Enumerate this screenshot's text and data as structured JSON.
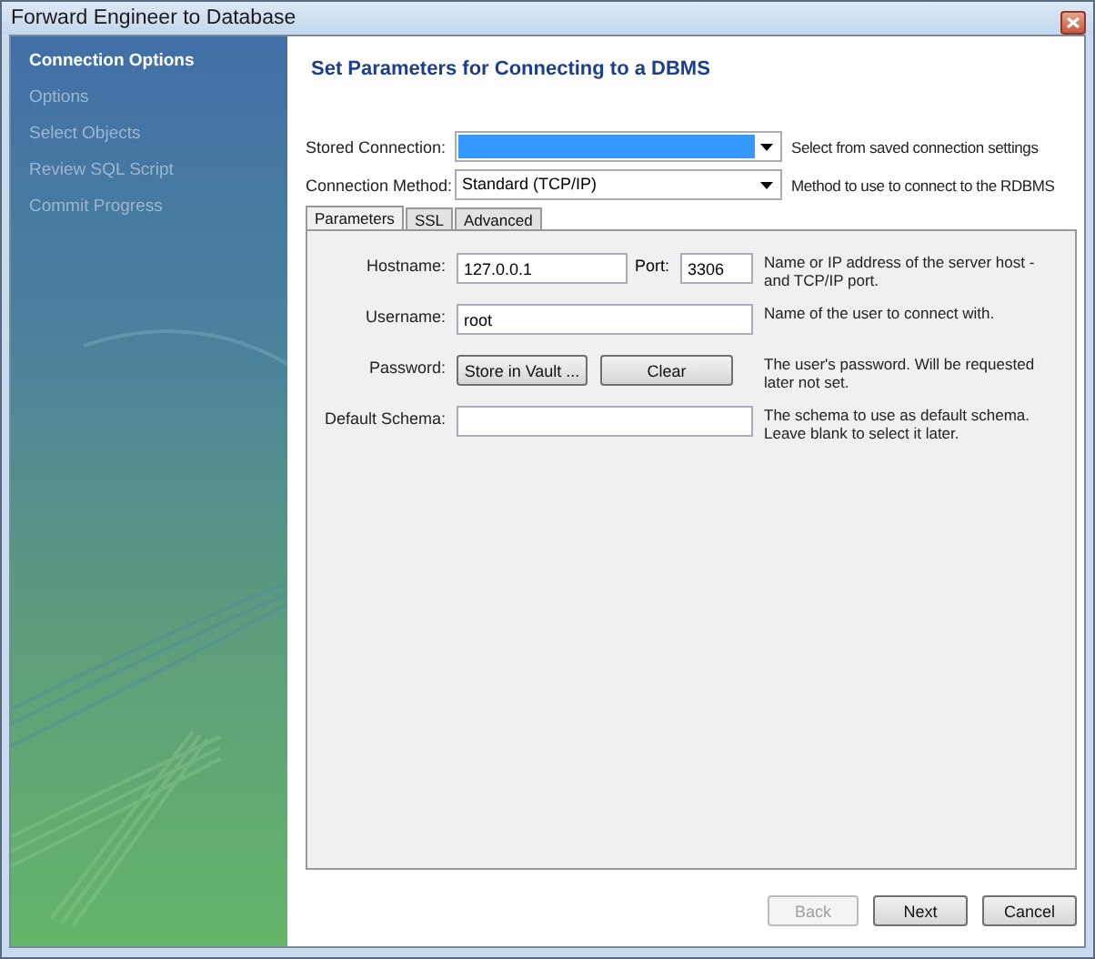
{
  "window": {
    "title": "Forward Engineer to Database"
  },
  "sidebar": {
    "items": [
      {
        "label": "Connection Options",
        "selected": true
      },
      {
        "label": "Options",
        "selected": false
      },
      {
        "label": "Select Objects",
        "selected": false
      },
      {
        "label": "Review SQL Script",
        "selected": false
      },
      {
        "label": "Commit Progress",
        "selected": false
      }
    ]
  },
  "heading": "Set Parameters for Connecting to a DBMS",
  "top_fields": [
    {
      "label": "Stored Connection:",
      "highlighted": true,
      "help": "Select from saved connection settings"
    },
    {
      "label": "Connection Method:",
      "value": "Standard (TCP/IP)",
      "highlighted": false,
      "help": "Method to use to connect to the RDBMS"
    }
  ],
  "tabs": [
    {
      "label": "Parameters",
      "selected": true
    },
    {
      "label": "SSL",
      "selected": false
    },
    {
      "label": "Advanced",
      "selected": false
    }
  ],
  "parameters": [
    {
      "kind": "host",
      "label": "Hostname:",
      "value": "127.0.0.1",
      "port_label": "Port:",
      "port_value": "3306",
      "help": "Name or IP address of the server host - and TCP/IP port."
    },
    {
      "kind": "text",
      "label": "Username:",
      "value": "root",
      "help": "Name of the user to connect with."
    },
    {
      "kind": "buttons",
      "label": "Password:",
      "buttons": [
        "Store in Vault ...",
        "Clear"
      ],
      "help": "The user's password. Will be requested later not set."
    },
    {
      "kind": "text",
      "label": "Default Schema:",
      "help": "The schema to use as default schema. Leave blank to select it later."
    }
  ],
  "buttons": [
    {
      "label": "Back",
      "disabled": true
    },
    {
      "label": "Next",
      "disabled": false
    },
    {
      "label": "Cancel",
      "disabled": false
    }
  ]
}
